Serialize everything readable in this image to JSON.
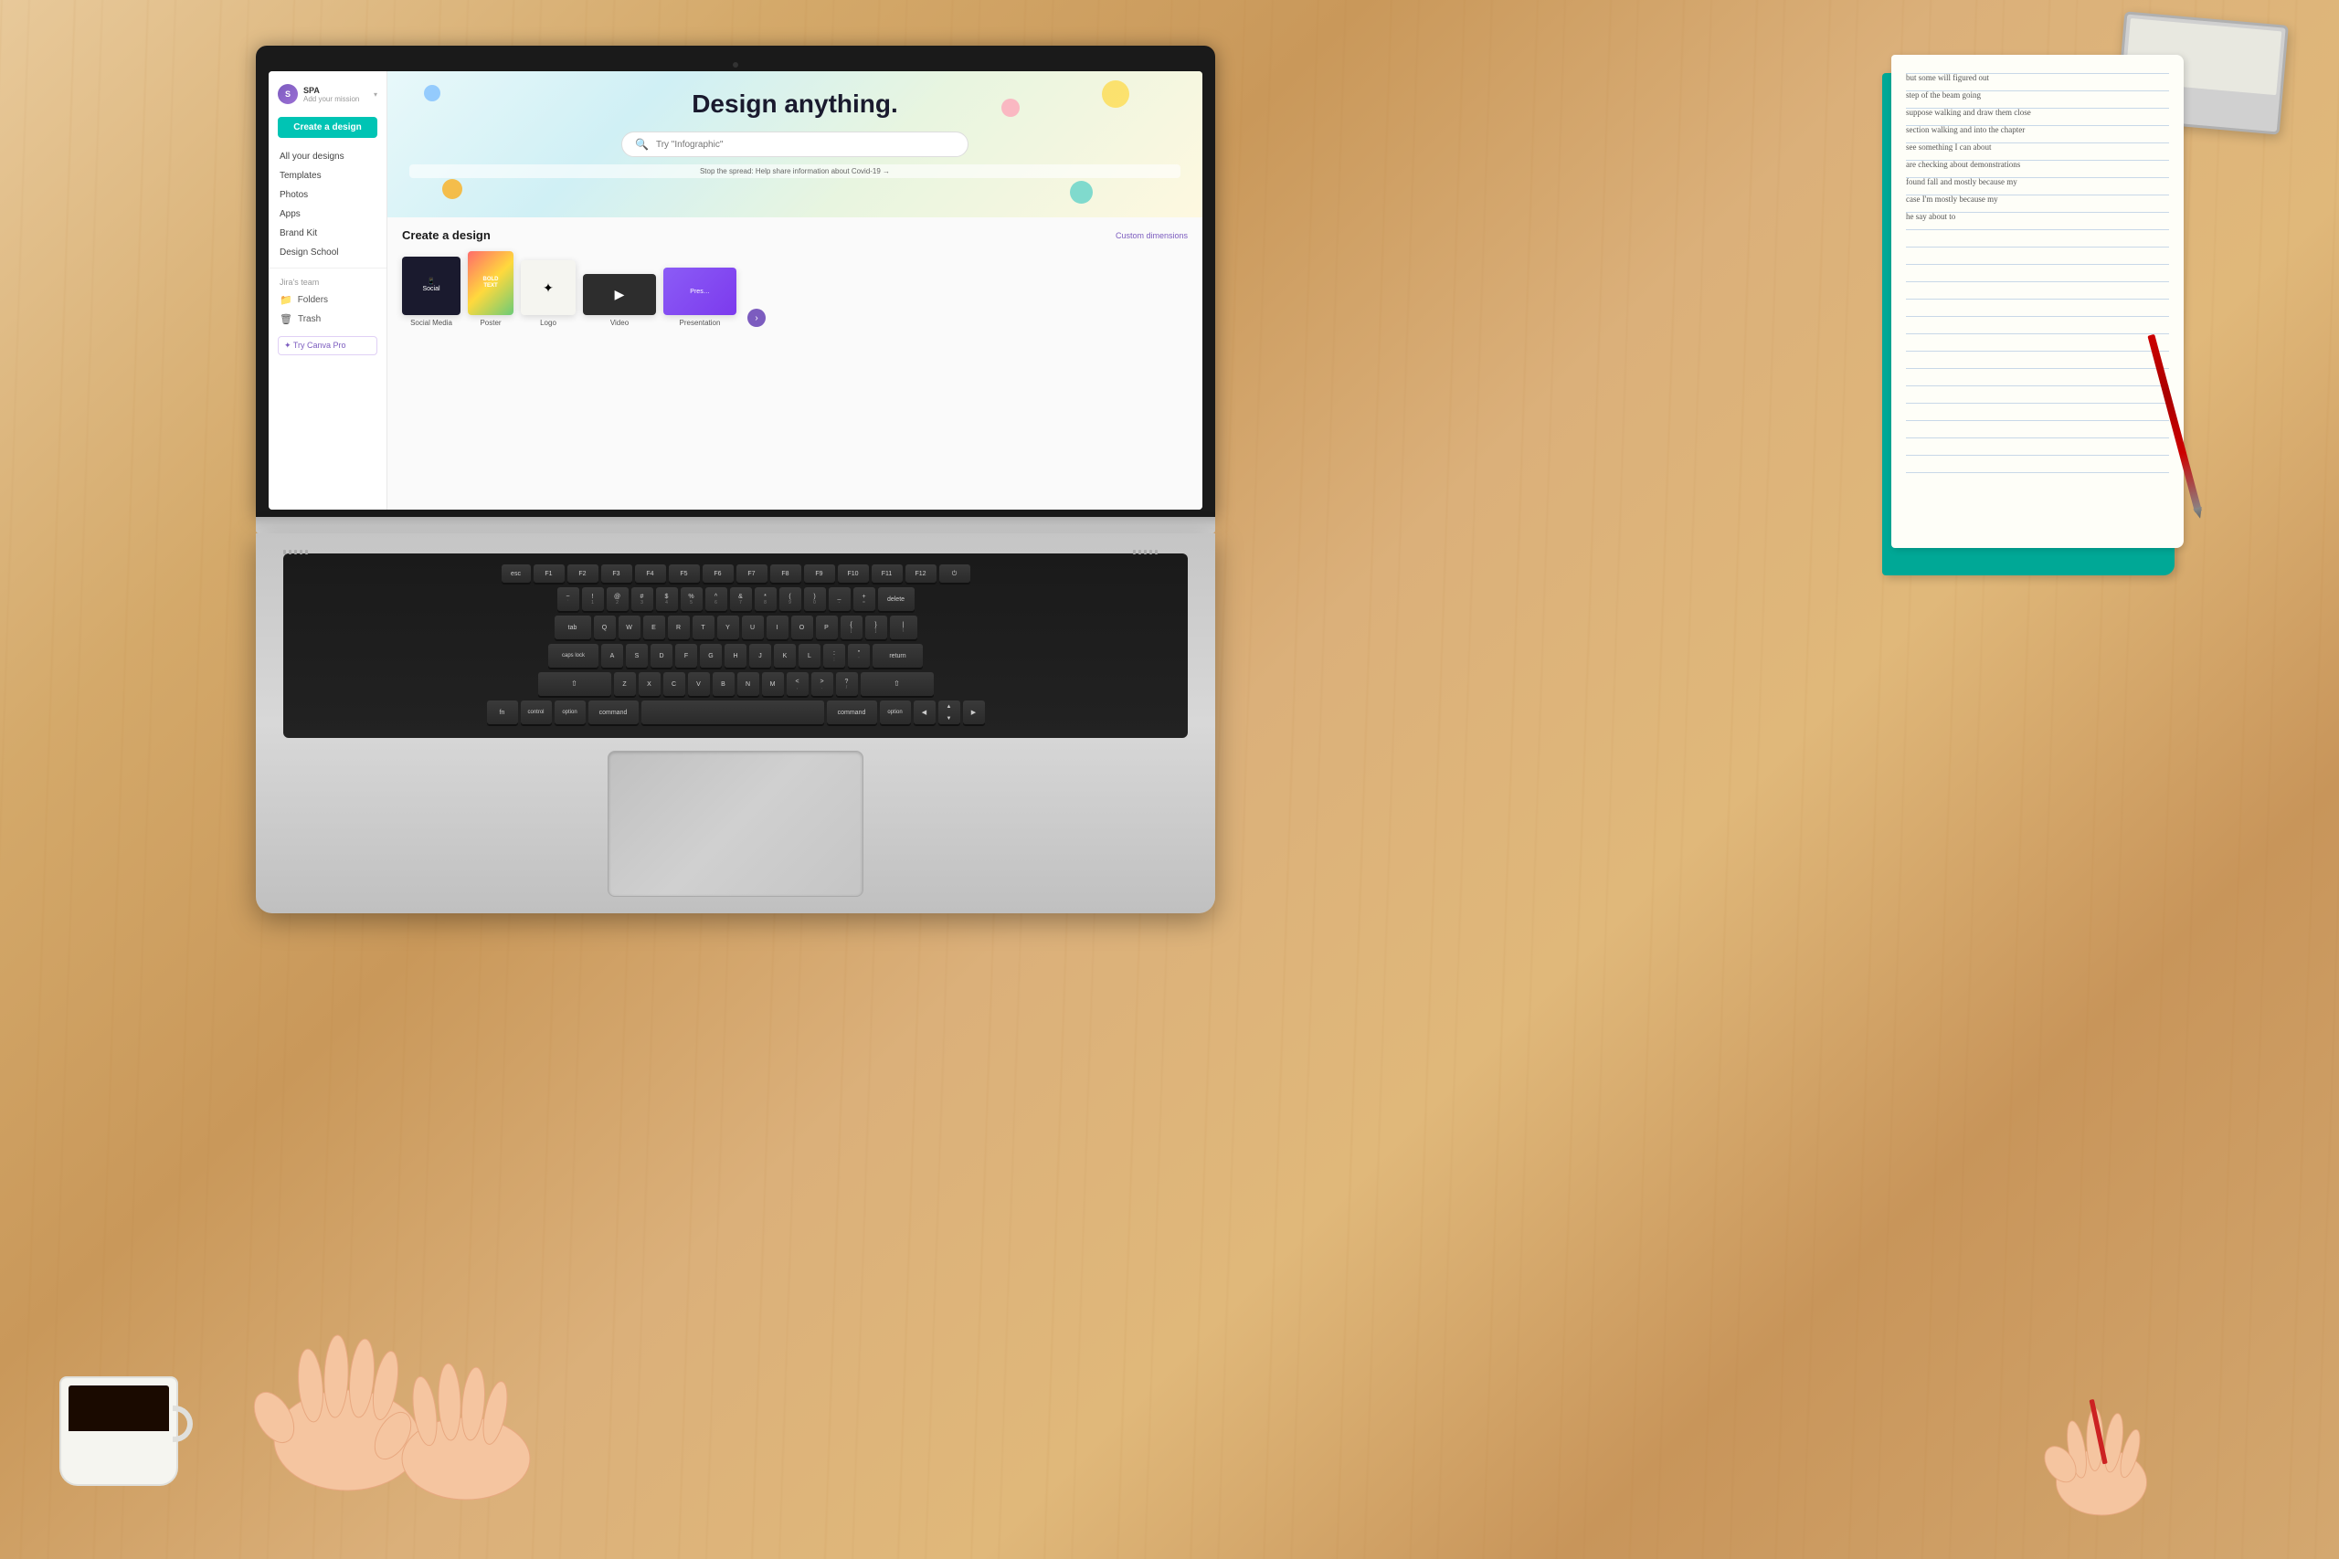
{
  "scene": {
    "alt": "Person using MacBook laptop with Canva open on desk with coffee and notebook"
  },
  "canva": {
    "hero_title": "Design anything.",
    "search_placeholder": "Try \"Infographic\"",
    "covid_banner": "Stop the spread: Help share information about Covid-19 →",
    "create_section_title": "Create a design",
    "custom_dimensions": "Custom dimensions",
    "create_button": "Create a design",
    "try_pro": "✦ Try Canva Pro"
  },
  "sidebar": {
    "user_initials": "S",
    "user_name": "SPA",
    "user_sub": "Add your mission",
    "nav_items": [
      {
        "label": "All your designs"
      },
      {
        "label": "Templates"
      },
      {
        "label": "Photos"
      },
      {
        "label": "Apps"
      },
      {
        "label": "Brand Kit"
      },
      {
        "label": "Design School"
      }
    ],
    "team_label": "Jira's team",
    "icon_items": [
      {
        "icon": "📁",
        "label": "Folders"
      },
      {
        "icon": "🗑",
        "label": "Trash"
      }
    ]
  },
  "templates": [
    {
      "label": "Social Media",
      "width": 64,
      "height": 64
    },
    {
      "label": "Poster",
      "width": 50,
      "height": 70
    },
    {
      "label": "Logo",
      "width": 60,
      "height": 60
    },
    {
      "label": "Video",
      "width": 80,
      "height": 45
    },
    {
      "label": "Presentation",
      "width": 80,
      "height": 52
    }
  ],
  "keyboard": {
    "command_key": "command",
    "option_key": "option",
    "fn_key": "fn"
  },
  "notebook": {
    "handwriting_lines": [
      "but some will figured out",
      "step of the beam going",
      "suppose walking and draw them close",
      "section walking and into the chapter",
      "see something I can about",
      "are checking about demonstrations",
      "found fall and mostly because my",
      "case I'm mostly because my",
      "he say about to"
    ]
  }
}
